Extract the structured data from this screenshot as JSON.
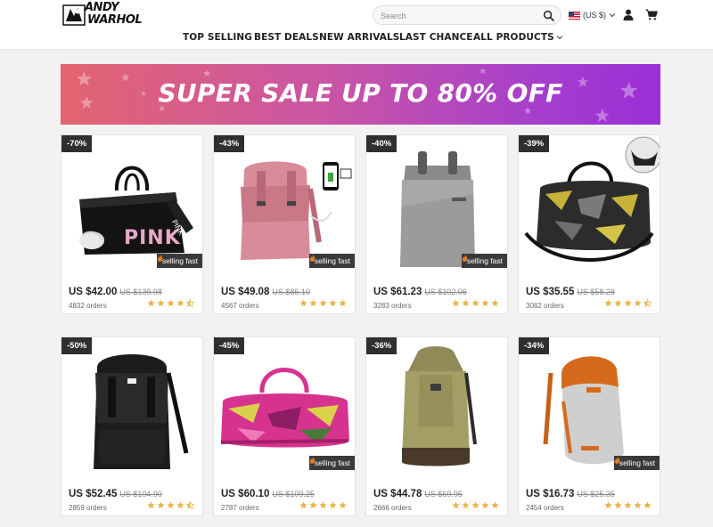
{
  "header": {
    "logo_line1": "ANDY",
    "logo_line2": "WARHOL",
    "search_placeholder": "Search",
    "currency": "(US $)",
    "icons": [
      "search-icon",
      "us-flag-icon",
      "chevron-down-icon",
      "user-icon",
      "cart-icon"
    ]
  },
  "nav": {
    "items": [
      "TOP SELLING",
      "BEST DEALS",
      "NEW ARRIVALS",
      "LAST CHANCE",
      "ALL PRODUCTS"
    ]
  },
  "banner": {
    "text": "SUPER SALE UP TO 80% OFF"
  },
  "labels": {
    "selling_fast": "selling fast"
  },
  "colors": {
    "accent_star": "#e8b54a",
    "badge_bg": "#2f2f2f",
    "banner_start": "#e36470",
    "banner_end": "#9b2ed6"
  },
  "products": [
    {
      "discount": "-70%",
      "price": "US $42.00",
      "old_price": "US $139.98",
      "orders": "4832 orders",
      "rating": 4.5,
      "selling_fast": true,
      "image": "black-pink-duffel-bag"
    },
    {
      "discount": "-43%",
      "price": "US $49.08",
      "old_price": "US $86.10",
      "orders": "4567 orders",
      "rating": 5,
      "selling_fast": true,
      "image": "pink-usb-backpack"
    },
    {
      "discount": "-40%",
      "price": "US $61.23",
      "old_price": "US $102.06",
      "orders": "3283 orders",
      "rating": 5,
      "selling_fast": true,
      "image": "grey-roll-top-backpack"
    },
    {
      "discount": "-39%",
      "price": "US $35.55",
      "old_price": "US $58.28",
      "orders": "3082 orders",
      "rating": 4.5,
      "selling_fast": false,
      "image": "camo-gym-duffel-bag"
    },
    {
      "discount": "-50%",
      "price": "US $52.45",
      "old_price": "US $104.90",
      "orders": "2859 orders",
      "rating": 4.5,
      "selling_fast": false,
      "image": "black-flap-backpack"
    },
    {
      "discount": "-45%",
      "price": "US $60.10",
      "old_price": "US $109.25",
      "orders": "2787 orders",
      "rating": 5,
      "selling_fast": true,
      "image": "pink-camo-duffel-bag"
    },
    {
      "discount": "-36%",
      "price": "US $44.78",
      "old_price": "US $69.95",
      "orders": "2666 orders",
      "rating": 5,
      "selling_fast": false,
      "image": "olive-canvas-bucket-backpack"
    },
    {
      "discount": "-34%",
      "price": "US $16.73",
      "old_price": "US $25.35",
      "orders": "2454 orders",
      "rating": 5,
      "selling_fast": true,
      "image": "orange-grey-backpack"
    }
  ]
}
